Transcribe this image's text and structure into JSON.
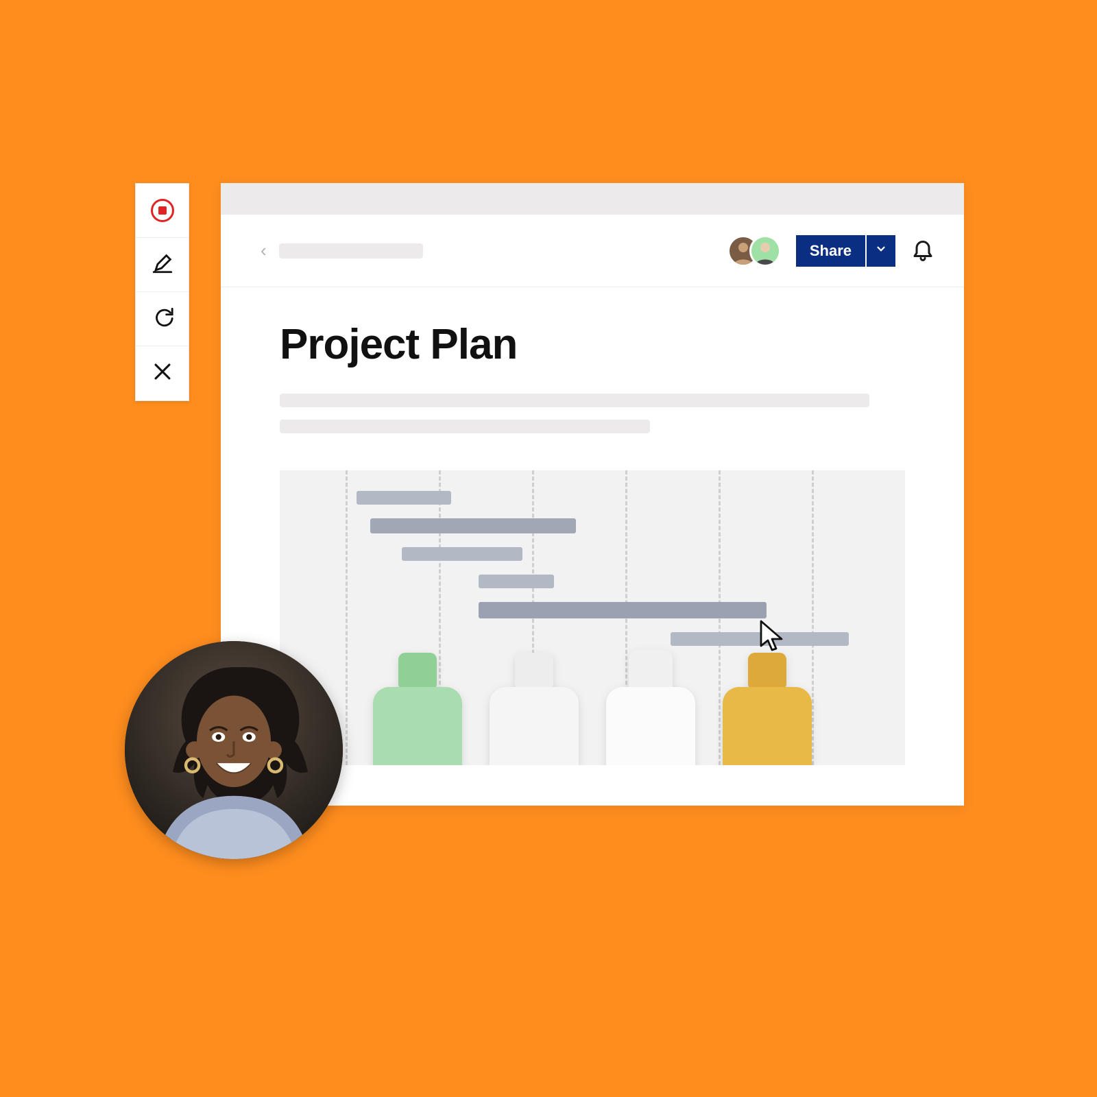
{
  "toolbar": {
    "record": "record-icon",
    "draw": "pencil-icon",
    "redo": "redo-icon",
    "close": "close-icon"
  },
  "header": {
    "share_label": "Share",
    "collaborator1": "avatar-user-1",
    "collaborator2": "avatar-user-2"
  },
  "document": {
    "title": "Project Plan"
  },
  "colors": {
    "accent": "#0a2e81",
    "background": "#ff8d1e",
    "record": "#e02424"
  },
  "chart_data": {
    "type": "gantt",
    "title": "",
    "columns": 6,
    "tasks": [
      {
        "start": 0.12,
        "duration": 0.15,
        "weight": "light"
      },
      {
        "start": 0.14,
        "duration": 0.33,
        "weight": "medium"
      },
      {
        "start": 0.19,
        "duration": 0.19,
        "weight": "light"
      },
      {
        "start": 0.32,
        "duration": 0.12,
        "weight": "light"
      },
      {
        "start": 0.32,
        "duration": 0.46,
        "weight": "heavy"
      },
      {
        "start": 0.62,
        "duration": 0.28,
        "weight": "light"
      }
    ]
  },
  "portrait": "presenter-avatar"
}
